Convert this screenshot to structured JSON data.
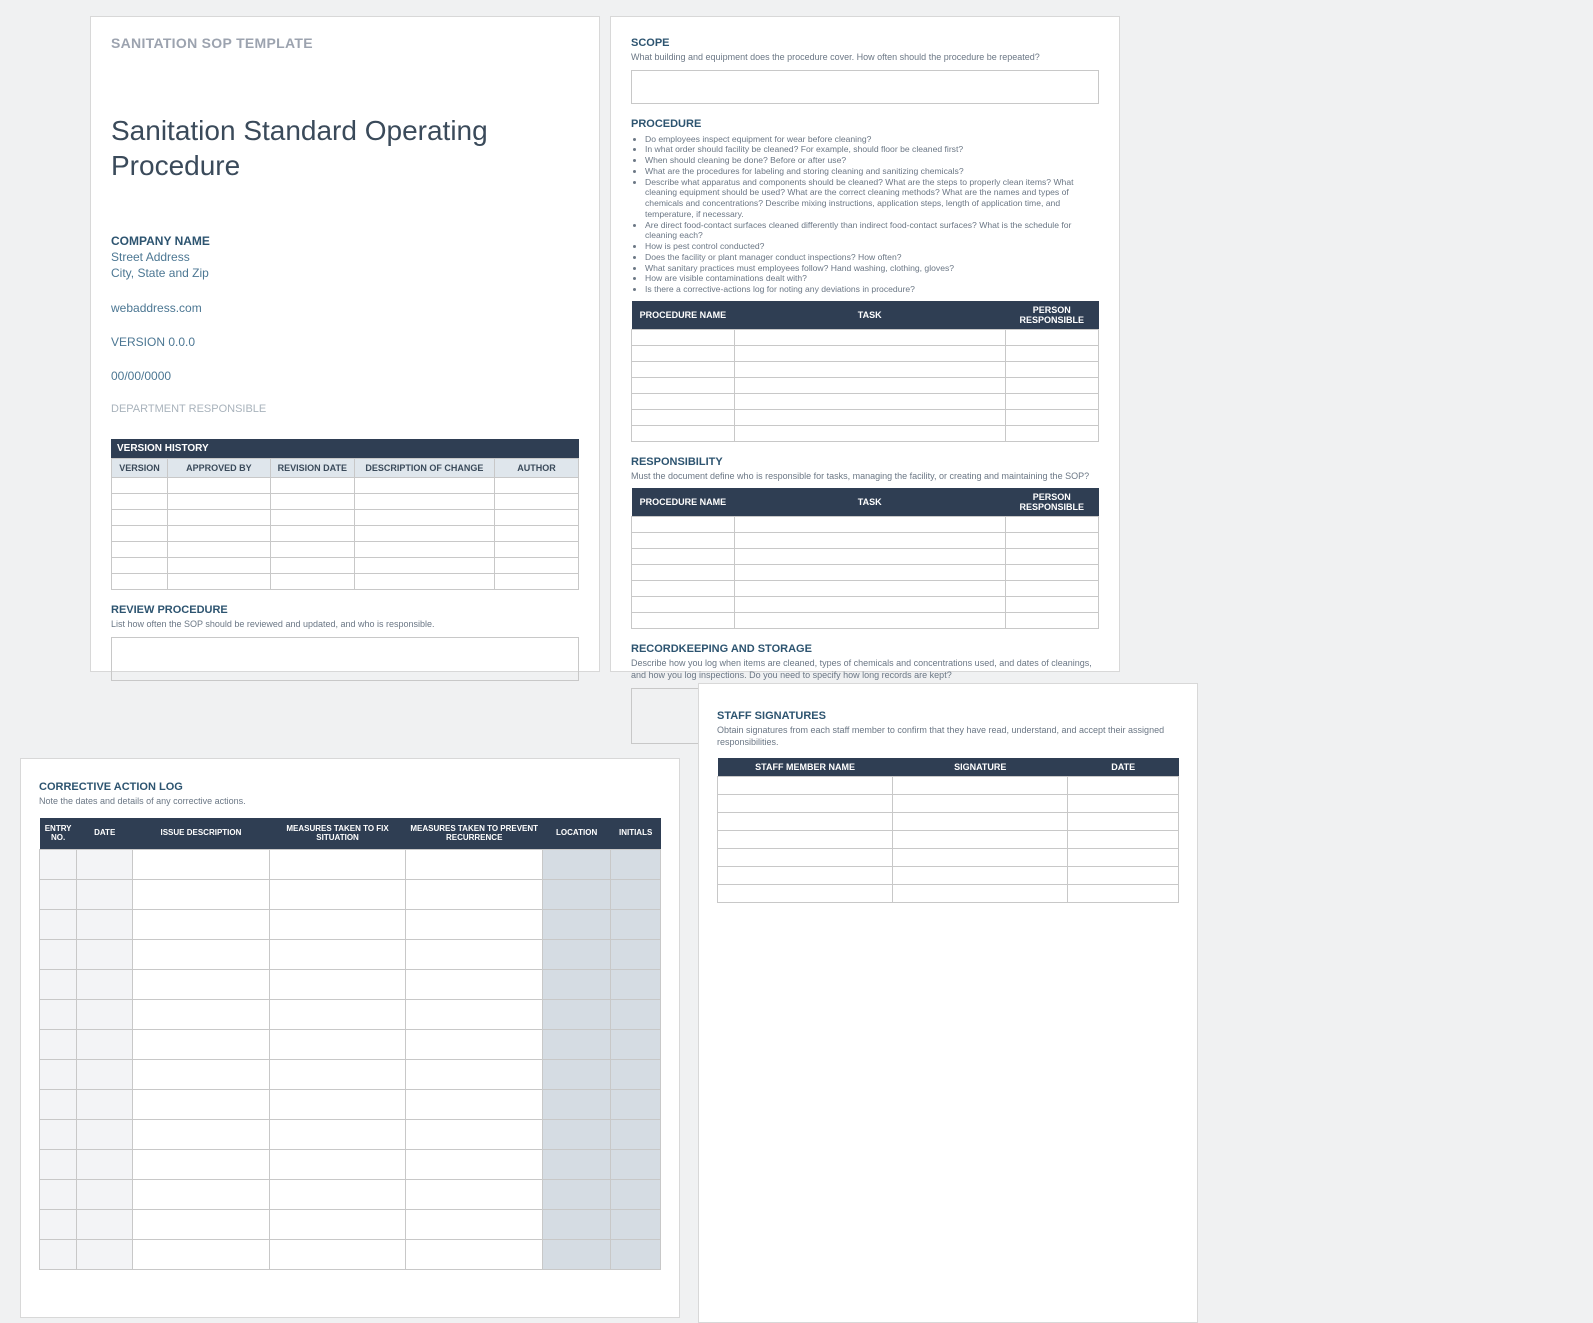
{
  "page1": {
    "template_label": "SANITATION SOP TEMPLATE",
    "title": "Sanitation Standard Operating Procedure",
    "company_name": "COMPANY NAME",
    "address1": "Street Address",
    "address2": "City, State and Zip",
    "web": "webaddress.com",
    "version": "VERSION 0.0.0",
    "date": "00/00/0000",
    "dept": "DEPARTMENT RESPONSIBLE",
    "version_history_label": "VERSION HISTORY",
    "vh_headers": {
      "version": "VERSION",
      "approved_by": "APPROVED BY",
      "revision_date": "REVISION DATE",
      "desc": "DESCRIPTION OF CHANGE",
      "author": "AUTHOR"
    },
    "review_head": "REVIEW PROCEDURE",
    "review_desc": "List how often the SOP should be reviewed and updated, and who is responsible."
  },
  "page2": {
    "scope_head": "SCOPE",
    "scope_desc": "What building and equipment does the procedure cover. How often should the procedure be repeated?",
    "procedure_head": "PROCEDURE",
    "bullets": [
      "Do employees inspect equipment for wear before cleaning?",
      "In what order should facility be cleaned? For example, should floor be cleaned first?",
      "When should cleaning be done? Before or after use?",
      "What are the procedures for labeling and storing cleaning and sanitizing chemicals?",
      "Describe what apparatus and components should be cleaned? What are the steps to properly clean items? What cleaning equipment should be used? What are the correct cleaning methods? What are the names and types of chemicals and concentrations? Describe mixing instructions, application steps, length of application time, and temperature, if necessary.",
      "Are direct food-contact surfaces cleaned differently than indirect food-contact surfaces? What is the schedule for cleaning each?",
      "How is pest control conducted?",
      "Does the facility or plant manager conduct inspections? How often?",
      "What sanitary practices must employees follow? Hand washing, clothing, gloves?",
      "How are visible contaminations dealt with?",
      "Is there a corrective-actions log for noting any deviations in procedure?"
    ],
    "proc_table_headers": {
      "name": "PROCEDURE NAME",
      "task": "TASK",
      "resp": "PERSON RESPONSIBLE"
    },
    "responsibility_head": "RESPONSIBILITY",
    "responsibility_desc": "Must the document define who is responsible for tasks, managing the facility, or creating and maintaining the SOP?",
    "recordkeeping_head": "RECORDKEEPING AND STORAGE",
    "recordkeeping_desc": "Describe how you log when items are cleaned, types of chemicals and concentrations used, and dates of cleanings, and how you log inspections. Do you need to specify how long records are kept?"
  },
  "page3": {
    "head": "CORRECTIVE ACTION LOG",
    "desc": "Note the dates and details of any corrective actions.",
    "headers": {
      "entry": "ENTRY NO.",
      "date": "DATE",
      "issue": "ISSUE DESCRIPTION",
      "fix": "MEASURES TAKEN TO FIX SITUATION",
      "prev": "MEASURES TAKEN TO PREVENT RECURRENCE",
      "loc": "LOCATION",
      "init": "INITIALS"
    }
  },
  "page4": {
    "head": "STAFF SIGNATURES",
    "desc": "Obtain signatures from each staff member to confirm that they have read, understand, and accept their assigned responsibilities.",
    "headers": {
      "name": "STAFF MEMBER NAME",
      "sig": "SIGNATURE",
      "date": "DATE"
    }
  }
}
